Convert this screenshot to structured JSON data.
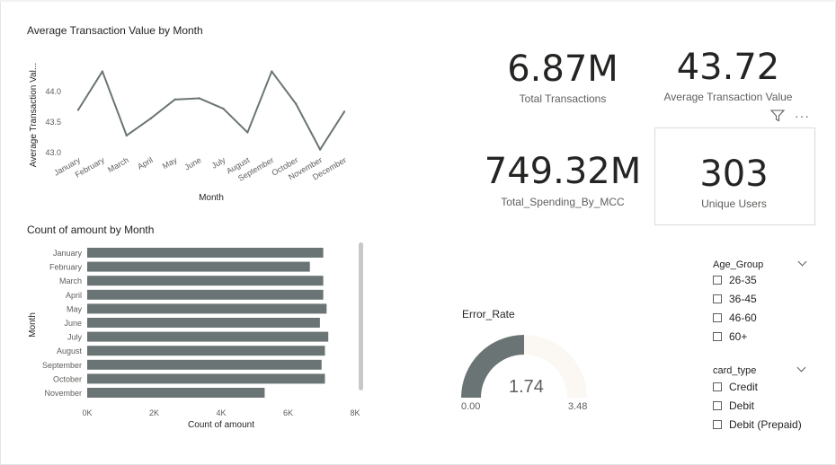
{
  "line_chart": {
    "title": "Average Transaction Value by Month",
    "xlabel": "Month",
    "ylabel": "Average Transaction Val...",
    "y_ticks": [
      "44.0",
      "43.5",
      "43.0"
    ]
  },
  "bar_chart": {
    "title": "Count of amount by Month",
    "xlabel": "Count of amount",
    "ylabel": "Month",
    "x_ticks": [
      "0K",
      "2K",
      "4K",
      "6K",
      "8K"
    ]
  },
  "kpis": {
    "total_transactions": {
      "value": "6.87M",
      "label": "Total Transactions"
    },
    "avg_transaction_value": {
      "value": "43.72",
      "label": "Average Transaction Value"
    },
    "total_spending": {
      "value": "749.32M",
      "label": "Total_Spending_By_MCC"
    },
    "unique_users": {
      "value": "303",
      "label": "Unique Users"
    }
  },
  "gauge": {
    "title": "Error_Rate",
    "value": 1.74,
    "value_label": "1.74",
    "min_label": "0.00",
    "max_label": "3.48",
    "fill_color": "#6b7474",
    "track_color": "#fbf8f4"
  },
  "slicers": {
    "age_group": {
      "title": "Age_Group",
      "options": [
        "26-35",
        "36-45",
        "46-60",
        "60+"
      ]
    },
    "card_type": {
      "title": "card_type",
      "options": [
        "Credit",
        "Debit",
        "Debit (Prepaid)"
      ]
    }
  },
  "icons": {
    "filter": "filter-icon",
    "more": "more-options-icon"
  },
  "colors": {
    "series": "#6b7474"
  },
  "chart_data": [
    {
      "type": "line",
      "title": "Average Transaction Value by Month",
      "xlabel": "Month",
      "ylabel": "Average Transaction Val...",
      "x": [
        "January",
        "February",
        "March",
        "April",
        "May",
        "June",
        "July",
        "August",
        "September",
        "October",
        "November",
        "December"
      ],
      "values": [
        43.7,
        44.33,
        43.28,
        43.56,
        43.87,
        43.89,
        43.72,
        43.33,
        44.33,
        43.8,
        43.05,
        43.67
      ],
      "ylim": [
        43.0,
        44.25
      ],
      "grid": false
    },
    {
      "type": "bar",
      "orientation": "horizontal",
      "title": "Count of amount by Month",
      "xlabel": "Count of amount",
      "ylabel": "Month",
      "categories": [
        "January",
        "February",
        "March",
        "April",
        "May",
        "June",
        "July",
        "August",
        "September",
        "October",
        "November"
      ],
      "values": [
        7050,
        6650,
        7050,
        7050,
        7150,
        6950,
        7200,
        7100,
        7000,
        7100,
        5300
      ],
      "xlim": [
        0,
        8000
      ],
      "grid": false
    }
  ]
}
